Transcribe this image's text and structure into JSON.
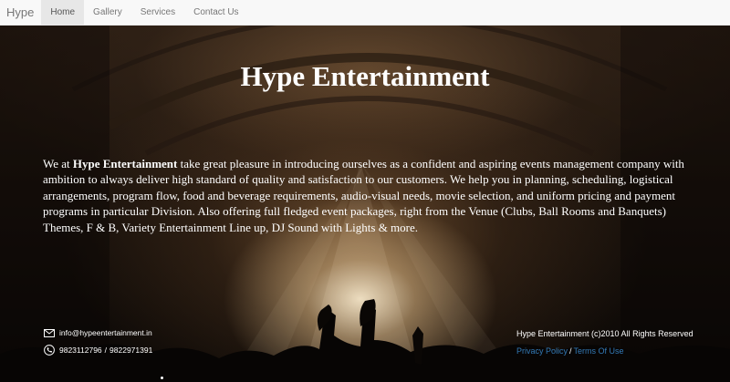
{
  "navbar": {
    "brand": "Hype",
    "items": [
      {
        "label": "Home",
        "active": true
      },
      {
        "label": "Gallery",
        "active": false
      },
      {
        "label": "Services",
        "active": false
      },
      {
        "label": "Contact Us",
        "active": false
      }
    ]
  },
  "hero": {
    "title": "Hype Entertainment",
    "intro": {
      "prefix": "We at ",
      "company": "Hype Entertainment",
      "body": " take great pleasure in introducing ourselves as a confident and aspiring events management company with ambition to always deliver high standard of quality and satisfaction to our customers. We help you in planning, scheduling, logistical arrangements, program flow, food and beverage requirements, audio-visual needs, movie selection, and uniform pricing and payment programs in particular Division. Also offering full fledged event packages, right from the Venue (Clubs, Ball Rooms and Banquets) Themes, F & B, Variety Entertainment Line up, DJ Sound with Lights & more."
    }
  },
  "contact": {
    "email": "info@hypeentertainment.in",
    "phone1": "9823112796",
    "separator": "/",
    "phone2": "9822971391",
    "email_icon": "envelope-icon",
    "phone_icon": "phone-icon"
  },
  "footer": {
    "copyright": "Hype Entertainment (c)2010 All Rights Reserved",
    "privacy_label": "Privacy Policy",
    "link_separator": "/",
    "terms_label": "Terms Of Use"
  },
  "colors": {
    "navbar_bg": "#f8f8f8",
    "active_tab_bg": "#e7e7e7",
    "link": "#337ab7",
    "text": "#ffffff"
  }
}
